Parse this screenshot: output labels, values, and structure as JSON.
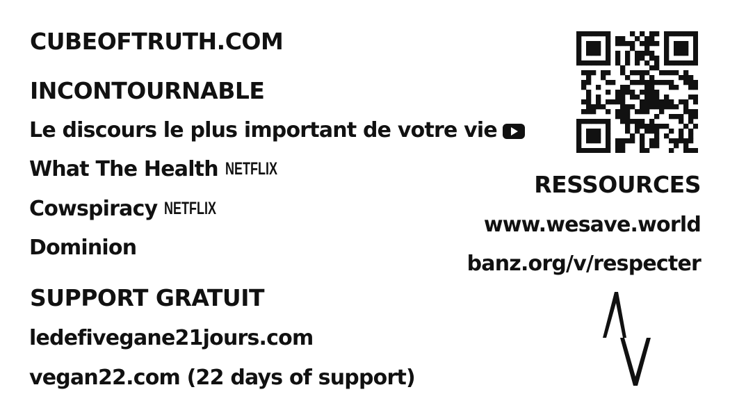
{
  "header": {
    "site": "CUBEOFTRUTH.COM"
  },
  "incontournable": {
    "title": "INCONTOURNABLE",
    "items": [
      {
        "label": "Le discours le plus important de votre vie",
        "icon": "youtube-icon"
      },
      {
        "label": "What The Health",
        "logo": "NETFLIX"
      },
      {
        "label": "Cowspiracy",
        "logo": "NETFLIX"
      },
      {
        "label": "Dominion"
      }
    ]
  },
  "support": {
    "title": "SUPPORT GRATUIT",
    "links": [
      "ledefivegane21jours.com",
      "vegan22.com (22 days of support)"
    ]
  },
  "ressources": {
    "title": "RESSOURCES",
    "links": [
      "www.wesave.world",
      "banz.org/v/respecter"
    ]
  },
  "icons": {
    "qr": "qr-code-icon",
    "brand": "anonymous-for-the-voiceless-logo-icon"
  },
  "colors": {
    "text": "#111111",
    "background": "#ffffff"
  }
}
